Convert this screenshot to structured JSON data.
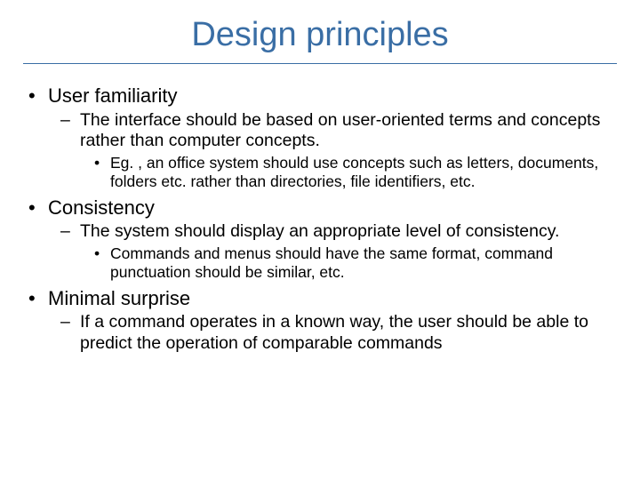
{
  "title": "Design principles",
  "items": [
    {
      "label": "User familiarity",
      "sub": [
        {
          "label": "The interface should be based on user-oriented terms and concepts rather than computer concepts.",
          "sub": [
            {
              "label": "Eg. , an office system should use concepts such as letters, documents, folders etc. rather than directories, file identifiers, etc."
            }
          ]
        }
      ]
    },
    {
      "label": "Consistency",
      "sub": [
        {
          "label": "The system should display an appropriate level of consistency.",
          "sub": [
            {
              "label": "Commands and menus should have the same format, command punctuation should be similar, etc."
            }
          ]
        }
      ]
    },
    {
      "label": "Minimal surprise",
      "sub": [
        {
          "label": "If a command operates in a known way, the user should be able to predict the operation of comparable commands"
        }
      ]
    }
  ]
}
